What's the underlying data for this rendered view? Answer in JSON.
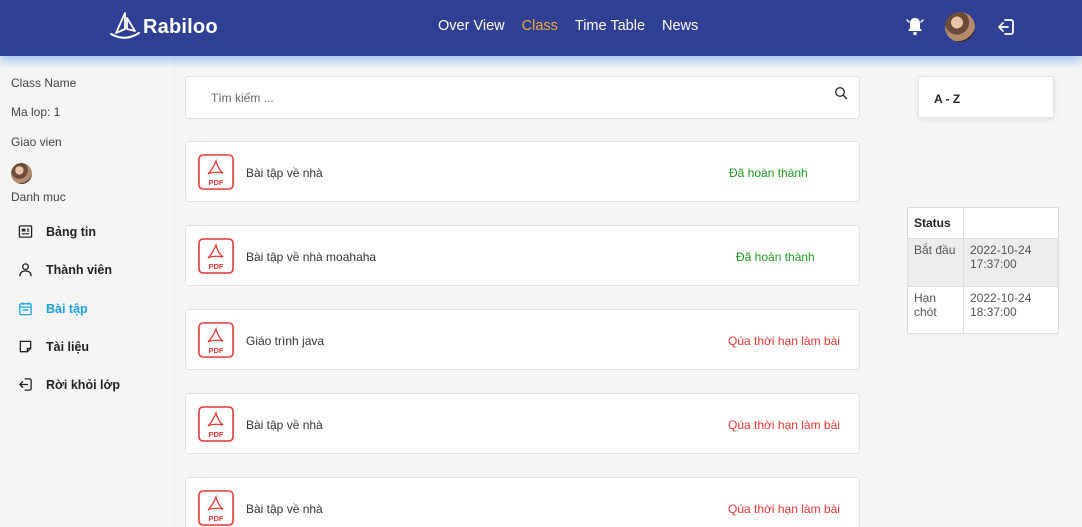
{
  "header": {
    "brand": "Rabiloo",
    "nav": [
      "Over View",
      "Class",
      "Time Table",
      "News"
    ],
    "active_nav": "Class",
    "accent_color": "#f2a93b",
    "bar_color": "#2f3f94"
  },
  "sidebar": {
    "class_name": "Class Name",
    "class_code": "Ma lop: 1",
    "teacher": "Giao vien",
    "category": "Danh muc",
    "menu": [
      {
        "label": "Bảng tin",
        "icon": "newspaper-icon"
      },
      {
        "label": "Thành viên",
        "icon": "user-icon"
      },
      {
        "label": "Bài tập",
        "icon": "calendar-icon",
        "active": true
      },
      {
        "label": "Tài liệu",
        "icon": "note-icon"
      },
      {
        "label": "Rời khỏi lớp",
        "icon": "logout-icon"
      }
    ]
  },
  "search": {
    "placeholder": "Tìm kiếm ..."
  },
  "assignments": [
    {
      "title": "Bài tập về nhà",
      "status": "Đã hoàn thành",
      "type": "done"
    },
    {
      "title": "Bài tập về nhà moahaha",
      "status": "Đã hoàn thành",
      "type": "done"
    },
    {
      "title": "Giáo trình java",
      "status": "Qúa thời hạn làm bài",
      "type": "late"
    },
    {
      "title": "Bài tập về nhà",
      "status": "Qúa thời hạn làm bài",
      "type": "late"
    },
    {
      "title": "Bài tập về nhà",
      "status": "Qúa thời hạn làm bài",
      "type": "late"
    }
  ],
  "file_icon_label": "PDF",
  "sort": {
    "label": "A - Z"
  },
  "status_table": {
    "header": "Status",
    "header_value": "",
    "rows": [
      {
        "label": "Bắt đầu",
        "value_date": "2022-10-24",
        "value_time": "17:37:00"
      },
      {
        "label_1": "Hạn",
        "label_2": "chót",
        "value_date": "2022-10-24",
        "value_time": "18:37:00"
      }
    ]
  }
}
